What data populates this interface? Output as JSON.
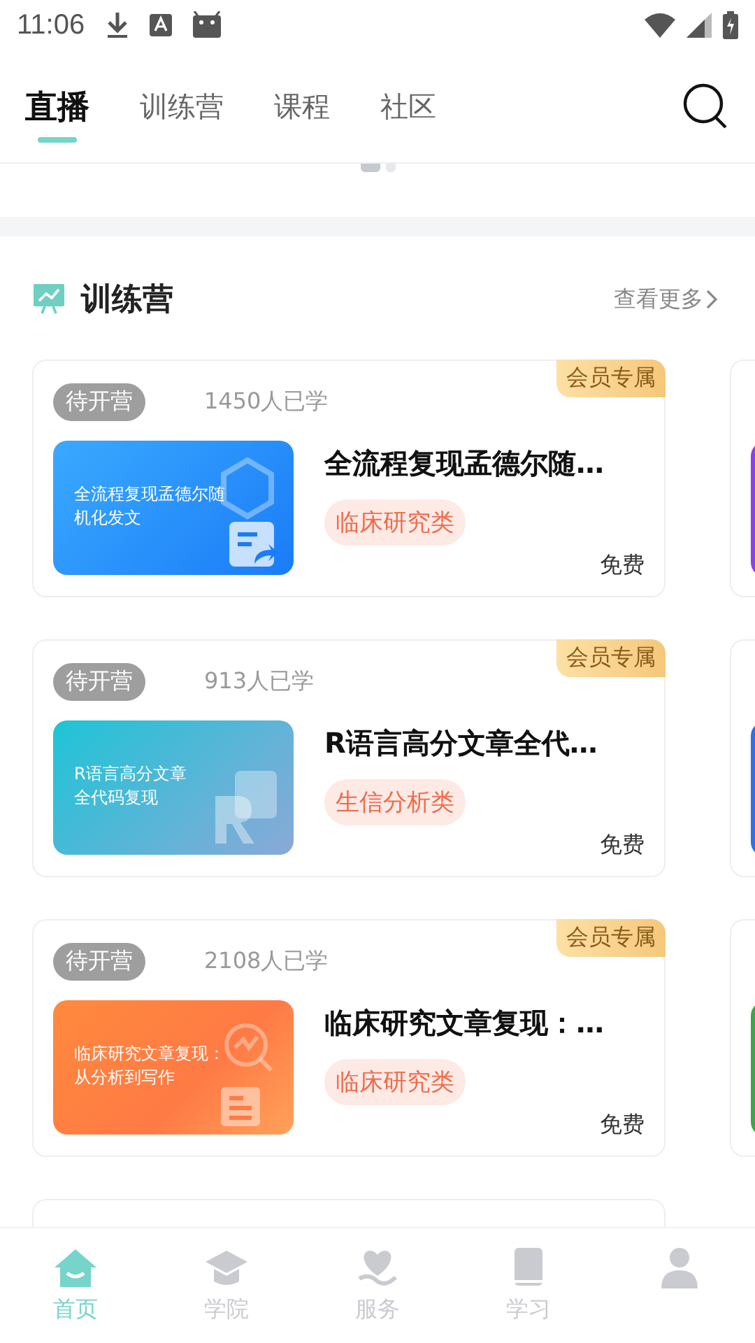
{
  "status_bar": {
    "time": "11:06"
  },
  "tabs": [
    {
      "label": "直播",
      "selected": true
    },
    {
      "label": "训练营",
      "selected": false
    },
    {
      "label": "课程",
      "selected": false
    },
    {
      "label": "社区",
      "selected": false
    }
  ],
  "carousel_dots": [
    {
      "selected": true
    },
    {
      "selected": false
    }
  ],
  "section": {
    "title": "训练营",
    "more": "查看更多"
  },
  "cards": [
    {
      "status": "待开营",
      "learners": "1450人已学",
      "badge": "会员专属",
      "title": "全流程复现孟德尔随…",
      "tag": "临床研究类",
      "price": "免费",
      "thumbnail_lines": [
        "全流程复现孟德尔随",
        "机化发文"
      ],
      "kind": "blue"
    },
    {
      "status": "待开营",
      "learners": "913人已学",
      "badge": "会员专属",
      "title": "R语言高分文章全代…",
      "tag": "生信分析类",
      "price": "免费",
      "thumbnail_lines": [
        "R语言高分文章",
        "全代码复现"
      ],
      "kind": "cyan"
    },
    {
      "status": "待开营",
      "learners": "2108人已学",
      "badge": "会员专属",
      "title": "临床研究文章复现：…",
      "tag": "临床研究类",
      "price": "免费",
      "thumbnail_lines": [
        "临床研究文章复现：",
        "从分析到写作"
      ],
      "kind": "orange"
    }
  ],
  "bottom_nav": [
    {
      "label": "首页",
      "kind": "home",
      "selected": true
    },
    {
      "label": "学院",
      "kind": "cap",
      "selected": false
    },
    {
      "label": "服务",
      "kind": "heart",
      "selected": false
    },
    {
      "label": "学习",
      "kind": "book",
      "selected": false
    },
    {
      "kind": "person",
      "selected": false
    }
  ]
}
